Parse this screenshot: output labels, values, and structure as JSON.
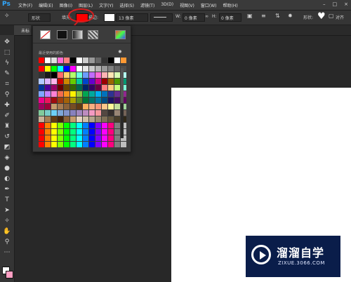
{
  "app": {
    "logo": "Ps"
  },
  "menu": [
    "文件(F)",
    "编辑(E)",
    "图像(I)",
    "图层(L)",
    "文字(Y)",
    "选择(S)",
    "滤镜(T)",
    "3D(D)",
    "视图(V)",
    "窗口(W)",
    "帮助(H)"
  ],
  "window_controls": [
    "–",
    "□",
    "×"
  ],
  "options": {
    "mode_label": "形状",
    "fill_label": "填充:",
    "stroke_label": "描边:",
    "stroke_size": "13 像素",
    "w_label": "W:",
    "w_value": "0 像素",
    "h_label": "H:",
    "h_value": "0 像素",
    "shape_label": "形状:",
    "align_label": "对齐"
  },
  "document_tab": {
    "label": "未标"
  },
  "popup": {
    "recent_label": "最近使用的颜色",
    "colors": {
      "fill": "#ff0000"
    }
  },
  "logo": {
    "name": "溜溜自学",
    "url": "ZIXUE.3066.COM"
  },
  "colors": {
    "foreground": "#ffffff",
    "background": "#ff9fc3",
    "accent": "#31a8ff",
    "annotation": "#d82020"
  }
}
